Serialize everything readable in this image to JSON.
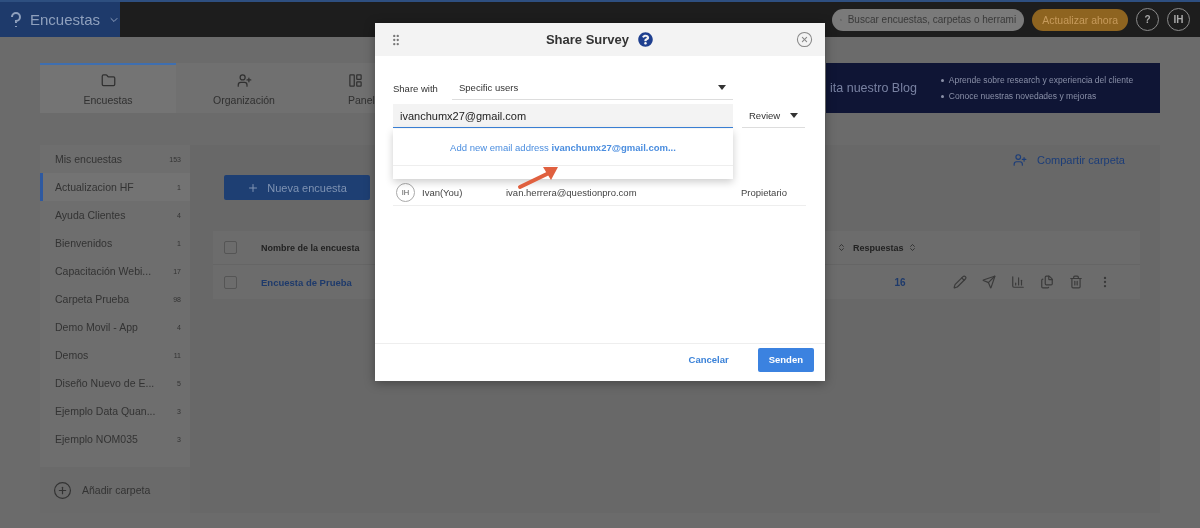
{
  "app": {
    "name": "Encuestas"
  },
  "search": {
    "placeholder": "Buscar encuestas, carpetas o herrami"
  },
  "upgrade_button": "Actualizar ahora",
  "help_button": "?",
  "user_initials": "IH",
  "nav_tabs": [
    {
      "label": "Encuestas",
      "selected": true,
      "kind": "folder"
    },
    {
      "label": "Organización",
      "selected": false,
      "kind": "users"
    },
    {
      "label": "Panel",
      "selected": false,
      "kind": "panel"
    }
  ],
  "blog_banner": {
    "title": "ita nuestro Blog",
    "bullets": [
      "Aprende sobre research y experiencia del cliente",
      "Conoce nuestras novedades y mejoras"
    ]
  },
  "folders": [
    {
      "name": "Mis encuestas",
      "count": "153",
      "selected": false
    },
    {
      "name": "Actualizacion HF",
      "count": "1",
      "selected": true
    },
    {
      "name": "Ayuda Clientes",
      "count": "4",
      "selected": false
    },
    {
      "name": "Bienvenidos",
      "count": "1",
      "selected": false
    },
    {
      "name": "Capacitación Webi...",
      "count": "17",
      "selected": false
    },
    {
      "name": "Carpeta Prueba",
      "count": "98",
      "selected": false
    },
    {
      "name": "Demo Movil - App",
      "count": "4",
      "selected": false
    },
    {
      "name": "Demos",
      "count": "11",
      "selected": false
    },
    {
      "name": "Diseño Nuevo de E...",
      "count": "5",
      "selected": false
    },
    {
      "name": "Ejemplo Data Quan...",
      "count": "3",
      "selected": false
    },
    {
      "name": "Ejemplo NOM035",
      "count": "3",
      "selected": false
    }
  ],
  "add_folder": "Añadir carpeta",
  "share_folder": "Compartir carpeta",
  "new_survey_button": "Nueva encuesta",
  "table": {
    "header_checked": false,
    "columns": [
      "Nombre de la encuesta",
      "Respuestas"
    ],
    "rows": [
      {
        "name": "Encuesta de Prueba",
        "responses": "16",
        "checked": false
      }
    ]
  },
  "modal": {
    "title": "Share Survey",
    "share_with_label": "Share with",
    "share_with_value": "Specific users",
    "email_value": "ivanchumx27@gmail.com",
    "permission": "Review",
    "suggestion": "Add new email address **ivanchumx27@gmail.com...**",
    "members": [
      {
        "initials": "IH",
        "name": "Ivan(You)",
        "email": "ivan.herrera@questionpro.com",
        "role": "Propietario"
      }
    ],
    "buttons": [
      {
        "label": "Cancelar",
        "kind": "secondary"
      },
      {
        "label": "Senden",
        "kind": "primary"
      }
    ]
  }
}
